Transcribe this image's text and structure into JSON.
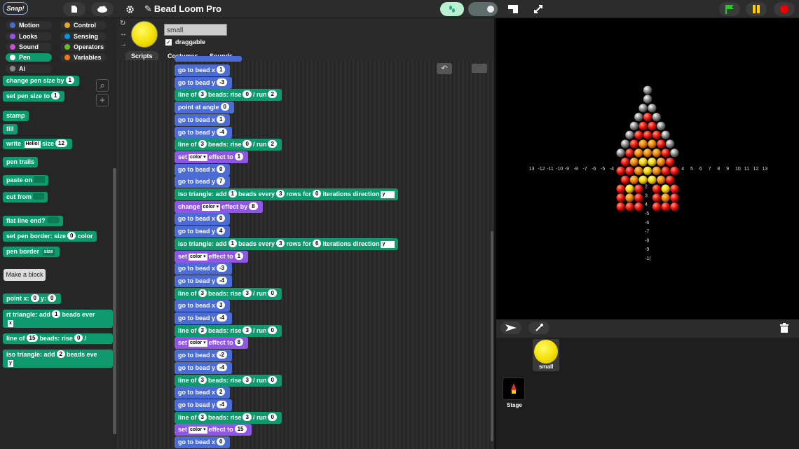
{
  "app": {
    "logo": "Snap!",
    "project_title": "Bead Loom Pro"
  },
  "categories": [
    {
      "label": "Motion",
      "color": "#4a6cd4"
    },
    {
      "label": "Control",
      "color": "#e6a822"
    },
    {
      "label": "Looks",
      "color": "#8f56e3"
    },
    {
      "label": "Sensing",
      "color": "#0494dc"
    },
    {
      "label": "Sound",
      "color": "#cf4ad9"
    },
    {
      "label": "Operators",
      "color": "#62c213"
    },
    {
      "label": "Pen",
      "color": "#0e9a6c"
    },
    {
      "label": "Variables",
      "color": "#f3761d"
    },
    {
      "label": "Ai",
      "color": "#888888"
    }
  ],
  "selected_category": "Pen",
  "palette": {
    "change_pen_size": {
      "label": "change pen size by",
      "v": "1"
    },
    "set_pen_size": {
      "label": "set pen size to",
      "v": "1"
    },
    "stamp": "stamp",
    "fill": "fill",
    "write": {
      "label": "write",
      "text": "Hello!",
      "size_label": "size",
      "size": "12"
    },
    "pen_trails": "pen trails",
    "paste_on": "paste on",
    "cut_from": "cut from",
    "flat_line_end": "flat line end?",
    "set_pen_border": {
      "label": "set pen border: size",
      "v": "0",
      "color": "color"
    },
    "pen_border": {
      "label": "pen border",
      "opt": "size"
    },
    "make_block": "Make a block",
    "point_xy": {
      "label": "point x:",
      "x": "0",
      "ylabel": "y:",
      "y": "0"
    },
    "rt_triangle": {
      "label": "rt triangle: add",
      "v": "1",
      "rest": "beads ever",
      "opt": "x"
    },
    "line_of": {
      "label": "line of",
      "v": "15",
      "rest": "beads: rise",
      "rise": "0",
      "sep": "/"
    },
    "iso_triangle": {
      "label": "iso triangle: add",
      "v": "2",
      "rest": "beads eve",
      "opt": "y"
    }
  },
  "sprite": {
    "name": "small",
    "draggable_label": "draggable",
    "tabs": [
      "Scripts",
      "Costumes",
      "Sounds"
    ]
  },
  "scripts": [
    {
      "t": "go_x",
      "v": "1"
    },
    {
      "t": "go_y",
      "v": "-3"
    },
    {
      "t": "line",
      "n": "3",
      "rise": "0",
      "run": "2"
    },
    {
      "t": "angle",
      "v": "0"
    },
    {
      "t": "go_x",
      "v": "1"
    },
    {
      "t": "go_y",
      "v": "-4"
    },
    {
      "t": "line",
      "n": "3",
      "rise": "0",
      "run": "2"
    },
    {
      "t": "set",
      "v": "1"
    },
    {
      "t": "go_x",
      "v": "0"
    },
    {
      "t": "go_y",
      "v": "7"
    },
    {
      "t": "iso",
      "a": "1",
      "b": "3",
      "c": "0"
    },
    {
      "t": "change",
      "v": "8"
    },
    {
      "t": "go_x",
      "v": "0"
    },
    {
      "t": "go_y",
      "v": "4"
    },
    {
      "t": "iso",
      "a": "1",
      "b": "3",
      "c": "6"
    },
    {
      "t": "set",
      "v": "1"
    },
    {
      "t": "go_x",
      "v": "-3"
    },
    {
      "t": "go_y",
      "v": "-4"
    },
    {
      "t": "line",
      "n": "3",
      "rise": "3",
      "run": "0"
    },
    {
      "t": "go_x",
      "v": "3"
    },
    {
      "t": "go_y",
      "v": "-4"
    },
    {
      "t": "line",
      "n": "3",
      "rise": "3",
      "run": "0"
    },
    {
      "t": "set",
      "v": "8"
    },
    {
      "t": "go_x",
      "v": "-2"
    },
    {
      "t": "go_y",
      "v": "-4"
    },
    {
      "t": "line",
      "n": "3",
      "rise": "3",
      "run": "0"
    },
    {
      "t": "go_x",
      "v": "2"
    },
    {
      "t": "go_y",
      "v": "-4"
    },
    {
      "t": "line",
      "n": "3",
      "rise": "3",
      "run": "0"
    },
    {
      "t": "set",
      "v": "15"
    },
    {
      "t": "go_x",
      "v": "0"
    }
  ],
  "block_text": {
    "go_x": "go to bead x",
    "go_y": "go to bead y",
    "line_of": "line of",
    "beads_rise": "beads: rise",
    "run": "/ run",
    "point_angle": "point at angle",
    "set": "set",
    "color": "color",
    "effect_to": "effect to",
    "change": "change",
    "effect_by": "effect by",
    "iso_add": "iso triangle: add",
    "beads_every": "beads every",
    "rows_for": "rows for",
    "iterations": "iterations direction",
    "dir": "y"
  },
  "stage_axes": {
    "x_left": [
      "13",
      "-12",
      "-11",
      "-10",
      "-9",
      "-8",
      "-7",
      "-6",
      "-5",
      "-4"
    ],
    "x_right": [
      "4",
      "5",
      "6",
      "7",
      "8",
      "9",
      "10",
      "11",
      "12",
      "13"
    ],
    "y_top_hidden": [],
    "y_labels": [
      "2",
      "3",
      "4",
      "-5",
      "-6",
      "-7",
      "-8",
      "-9",
      "-1("
    ]
  },
  "corral": {
    "sprite_name": "small",
    "stage_label": "Stage"
  }
}
